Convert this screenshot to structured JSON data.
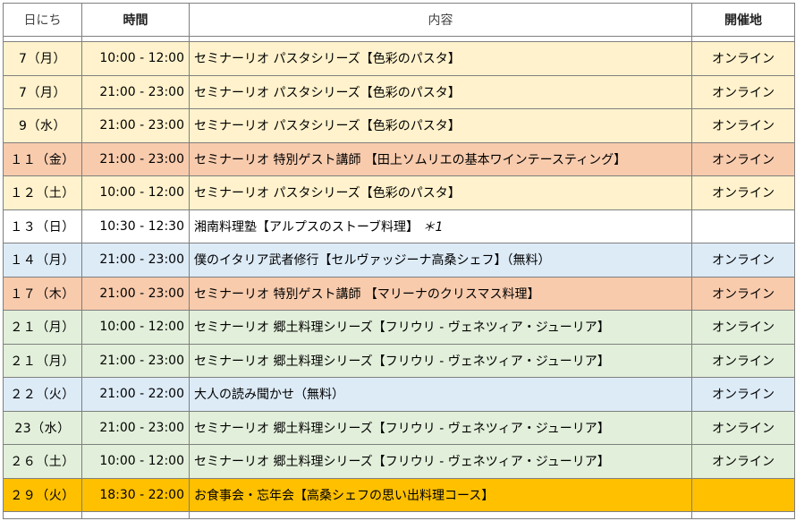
{
  "header": {
    "date": "日にち",
    "time": "時間",
    "content": "内容",
    "venue": "開催地"
  },
  "rows": [
    {
      "date": "7（月）",
      "time": "10:00 - 12:00",
      "content": "セミナーリオ パスタシリーズ【色彩のパスタ】",
      "venue": "オンライン",
      "color": "#fff2cc"
    },
    {
      "date": "7（月）",
      "time": "21:00 - 23:00",
      "content": "セミナーリオ パスタシリーズ【色彩のパスタ】",
      "venue": "オンライン",
      "color": "#fff2cc"
    },
    {
      "date": "9（水）",
      "time": "21:00 - 23:00",
      "content": "セミナーリオ パスタシリーズ【色彩のパスタ】",
      "venue": "オンライン",
      "color": "#fff2cc"
    },
    {
      "date": "１１（金）",
      "time": "21:00 - 23:00",
      "content": "セミナーリオ 特別ゲスト講師 【田上ソムリエの基本ワインテースティング】",
      "venue": "オンライン",
      "color": "#f8cbad"
    },
    {
      "date": "１２（土）",
      "time": "10:00 - 12:00",
      "content": "セミナーリオ パスタシリーズ【色彩のパスタ】",
      "venue": "オンライン",
      "color": "#fff2cc"
    },
    {
      "date": "１３（日）",
      "time": "10:30 - 12:30",
      "content": "湘南料理塾【アルプスのストーブ料理】",
      "note": "＊1",
      "venue": "",
      "color": "#ffffff"
    },
    {
      "date": "１４（月）",
      "time": "21:00 - 23:00",
      "content": "僕のイタリア武者修行【セルヴァッジーナ高桑シェフ】（無料）",
      "venue": "オンライン",
      "color": "#ddebf7"
    },
    {
      "date": "１７（木）",
      "time": "21:00 - 23:00",
      "content": "セミナーリオ 特別ゲスト講師 【マリーナのクリスマス料理】",
      "venue": "オンライン",
      "color": "#f8cbad"
    },
    {
      "date": "２１（月）",
      "time": "10:00 - 12:00",
      "content": "セミナーリオ 郷土料理シリーズ【フリウリ - ヴェネツィア・ジューリア】",
      "venue": "オンライン",
      "color": "#e2efda"
    },
    {
      "date": "２１（月）",
      "time": "21:00 - 23:00",
      "content": "セミナーリオ 郷土料理シリーズ【フリウリ - ヴェネツィア・ジューリア】",
      "venue": "オンライン",
      "color": "#e2efda"
    },
    {
      "date": "２２（火）",
      "time": "21:00 - 22:00",
      "content": "大人の読み聞かせ（無料）",
      "venue": "オンライン",
      "color": "#ddebf7"
    },
    {
      "date": "23（水）",
      "time": "21:00 - 23:00",
      "content": "セミナーリオ 郷土料理シリーズ【フリウリ - ヴェネツィア・ジューリア】",
      "venue": "オンライン",
      "color": "#e2efda"
    },
    {
      "date": "２６（土）",
      "time": "10:00 - 12:00",
      "content": "セミナーリオ 郷土料理シリーズ【フリウリ - ヴェネツィア・ジューリア】",
      "venue": "オンライン",
      "color": "#e2efda"
    },
    {
      "date": "２９（火）",
      "time": "18:30 - 22:00",
      "content": "お食事会・忘年会【高桑シェフの思い出料理コース】",
      "venue": "",
      "color": "#ffc000"
    }
  ]
}
